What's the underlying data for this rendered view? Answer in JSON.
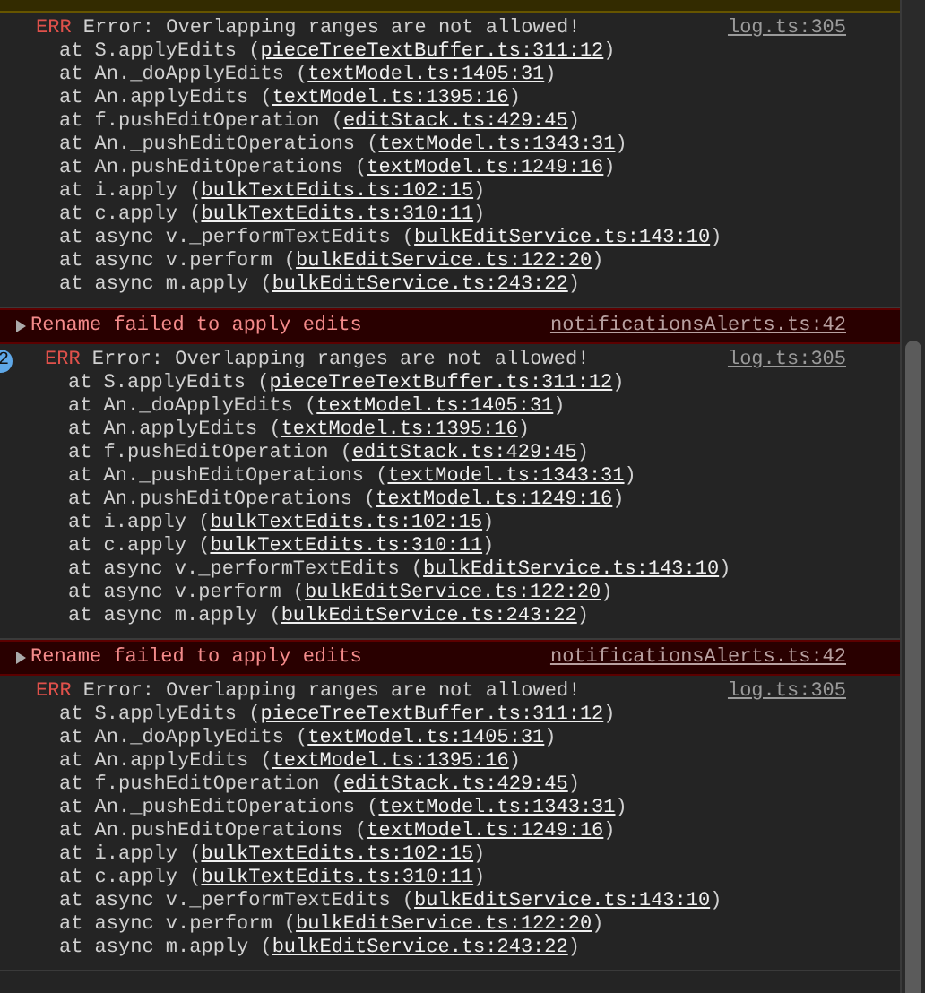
{
  "entries": [
    {
      "kind": "error",
      "level": "ERR",
      "message": "Error: Overlapping ranges are not allowed!",
      "source": "log.ts:305",
      "frames": [
        {
          "text": "at S.applyEdits (",
          "link": "pieceTreeTextBuffer.ts:311:12",
          "close": ")"
        },
        {
          "text": "at An._doApplyEdits (",
          "link": "textModel.ts:1405:31",
          "close": ")"
        },
        {
          "text": "at An.applyEdits (",
          "link": "textModel.ts:1395:16",
          "close": ")"
        },
        {
          "text": "at f.pushEditOperation (",
          "link": "editStack.ts:429:45",
          "close": ")"
        },
        {
          "text": "at An._pushEditOperations (",
          "link": "textModel.ts:1343:31",
          "close": ")"
        },
        {
          "text": "at An.pushEditOperations (",
          "link": "textModel.ts:1249:16",
          "close": ")"
        },
        {
          "text": "at i.apply (",
          "link": "bulkTextEdits.ts:102:15",
          "close": ")"
        },
        {
          "text": "at c.apply (",
          "link": "bulkTextEdits.ts:310:11",
          "close": ")"
        },
        {
          "text": "at async v._performTextEdits (",
          "link": "bulkEditService.ts:143:10",
          "close": ")"
        },
        {
          "text": "at async v.perform (",
          "link": "bulkEditService.ts:122:20",
          "close": ")"
        },
        {
          "text": "at async m.apply (",
          "link": "bulkEditService.ts:243:22",
          "close": ")"
        }
      ]
    },
    {
      "kind": "rename",
      "expanded": false,
      "message": "Rename failed to apply edits",
      "source": "notificationsAlerts.ts:42"
    },
    {
      "kind": "error",
      "count": "2",
      "level": "ERR",
      "message": "Error: Overlapping ranges are not allowed!",
      "source": "log.ts:305",
      "frames": [
        {
          "text": "at S.applyEdits (",
          "link": "pieceTreeTextBuffer.ts:311:12",
          "close": ")"
        },
        {
          "text": "at An._doApplyEdits (",
          "link": "textModel.ts:1405:31",
          "close": ")"
        },
        {
          "text": "at An.applyEdits (",
          "link": "textModel.ts:1395:16",
          "close": ")"
        },
        {
          "text": "at f.pushEditOperation (",
          "link": "editStack.ts:429:45",
          "close": ")"
        },
        {
          "text": "at An._pushEditOperations (",
          "link": "textModel.ts:1343:31",
          "close": ")"
        },
        {
          "text": "at An.pushEditOperations (",
          "link": "textModel.ts:1249:16",
          "close": ")"
        },
        {
          "text": "at i.apply (",
          "link": "bulkTextEdits.ts:102:15",
          "close": ")"
        },
        {
          "text": "at c.apply (",
          "link": "bulkTextEdits.ts:310:11",
          "close": ")"
        },
        {
          "text": "at async v._performTextEdits (",
          "link": "bulkEditService.ts:143:10",
          "close": ")"
        },
        {
          "text": "at async v.perform (",
          "link": "bulkEditService.ts:122:20",
          "close": ")"
        },
        {
          "text": "at async m.apply (",
          "link": "bulkEditService.ts:243:22",
          "close": ")"
        }
      ]
    },
    {
      "kind": "rename",
      "expanded": false,
      "message": "Rename failed to apply edits",
      "source": "notificationsAlerts.ts:42"
    },
    {
      "kind": "error",
      "level": "ERR",
      "message": "Error: Overlapping ranges are not allowed!",
      "source": "log.ts:305",
      "frames": [
        {
          "text": "at S.applyEdits (",
          "link": "pieceTreeTextBuffer.ts:311:12",
          "close": ")"
        },
        {
          "text": "at An._doApplyEdits (",
          "link": "textModel.ts:1405:31",
          "close": ")"
        },
        {
          "text": "at An.applyEdits (",
          "link": "textModel.ts:1395:16",
          "close": ")"
        },
        {
          "text": "at f.pushEditOperation (",
          "link": "editStack.ts:429:45",
          "close": ")"
        },
        {
          "text": "at An._pushEditOperations (",
          "link": "textModel.ts:1343:31",
          "close": ")"
        },
        {
          "text": "at An.pushEditOperations (",
          "link": "textModel.ts:1249:16",
          "close": ")"
        },
        {
          "text": "at i.apply (",
          "link": "bulkTextEdits.ts:102:15",
          "close": ")"
        },
        {
          "text": "at c.apply (",
          "link": "bulkTextEdits.ts:310:11",
          "close": ")"
        },
        {
          "text": "at async v._performTextEdits (",
          "link": "bulkEditService.ts:143:10",
          "close": ")"
        },
        {
          "text": "at async v.perform (",
          "link": "bulkEditService.ts:122:20",
          "close": ")"
        },
        {
          "text": "at async m.apply (",
          "link": "bulkEditService.ts:243:22",
          "close": ")"
        }
      ]
    }
  ]
}
